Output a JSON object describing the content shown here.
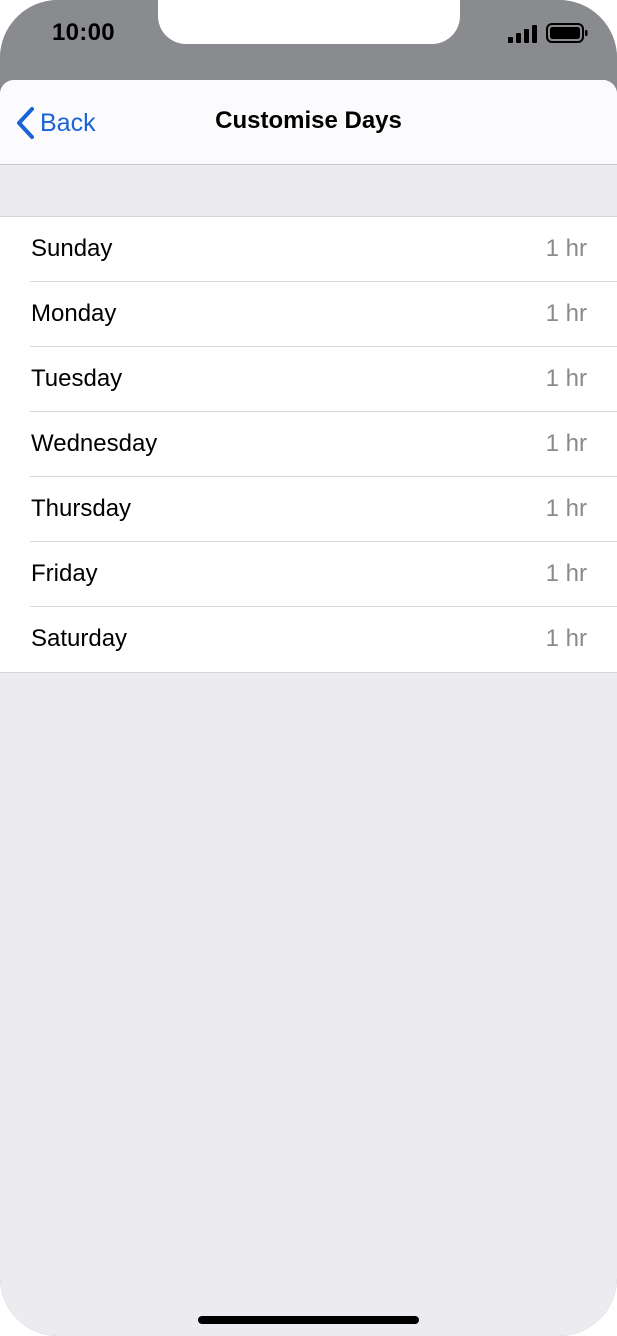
{
  "status_bar": {
    "time": "10:00",
    "signal_icon": "cellular-signal-icon",
    "battery_icon": "battery-icon"
  },
  "nav": {
    "back_label": "Back",
    "back_icon": "chevron-left-icon",
    "title": "Customise Days"
  },
  "days": [
    {
      "label": "Sunday",
      "value": "1 hr"
    },
    {
      "label": "Monday",
      "value": "1 hr"
    },
    {
      "label": "Tuesday",
      "value": "1 hr"
    },
    {
      "label": "Wednesday",
      "value": "1 hr"
    },
    {
      "label": "Thursday",
      "value": "1 hr"
    },
    {
      "label": "Friday",
      "value": "1 hr"
    },
    {
      "label": "Saturday",
      "value": "1 hr"
    }
  ],
  "colors": {
    "accent": "#1a62d8",
    "secondary_text": "#8a8a8e",
    "grouped_background": "#ebebf0",
    "status_bar_background": "#8a8b8f"
  }
}
